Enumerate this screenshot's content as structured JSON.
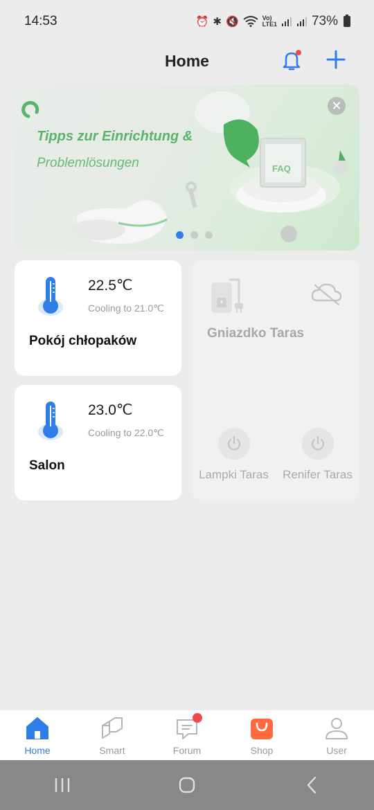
{
  "status_bar": {
    "time": "14:53",
    "battery": "73%",
    "icons": [
      "alarm-icon",
      "bluetooth-icon",
      "mute-icon",
      "wifi-icon",
      "volte-icon",
      "signal-icon",
      "signal-icon",
      "battery-icon"
    ]
  },
  "header": {
    "title": "Home",
    "bell_has_notification": true
  },
  "banner": {
    "line1": "Tipps zur Einrichtung &",
    "line2": "Problemlösungen",
    "faq_label": "FAQ",
    "close_glyph": "✕",
    "page_count": 3,
    "active_page": 1
  },
  "devices": [
    {
      "type": "thermostat",
      "temperature": "22.5℃",
      "status": "Cooling to 21.0℃",
      "name": "Pokój chłopaków"
    },
    {
      "type": "thermostat",
      "temperature": "23.0℃",
      "status": "Cooling to 22.0℃",
      "name": "Salon"
    }
  ],
  "power_strip": {
    "name": "Gniazdko Taras",
    "state": "offline",
    "outlets": [
      {
        "label": "Lampki Taras"
      },
      {
        "label": "Renifer Taras"
      }
    ]
  },
  "bottom_nav": {
    "items": [
      {
        "label": "Home",
        "icon": "home-icon",
        "active": true
      },
      {
        "label": "Smart",
        "icon": "smart-icon",
        "active": false
      },
      {
        "label": "Forum",
        "icon": "forum-icon",
        "active": false,
        "badge": true
      },
      {
        "label": "Shop",
        "icon": "shop-icon",
        "active": false
      },
      {
        "label": "User",
        "icon": "user-icon",
        "active": false
      }
    ]
  },
  "colors": {
    "accent": "#2f7de7",
    "background": "#ececec",
    "banner_text": "#5bb36b",
    "badge": "#f24a4a",
    "shop": "#ff6a3d"
  }
}
